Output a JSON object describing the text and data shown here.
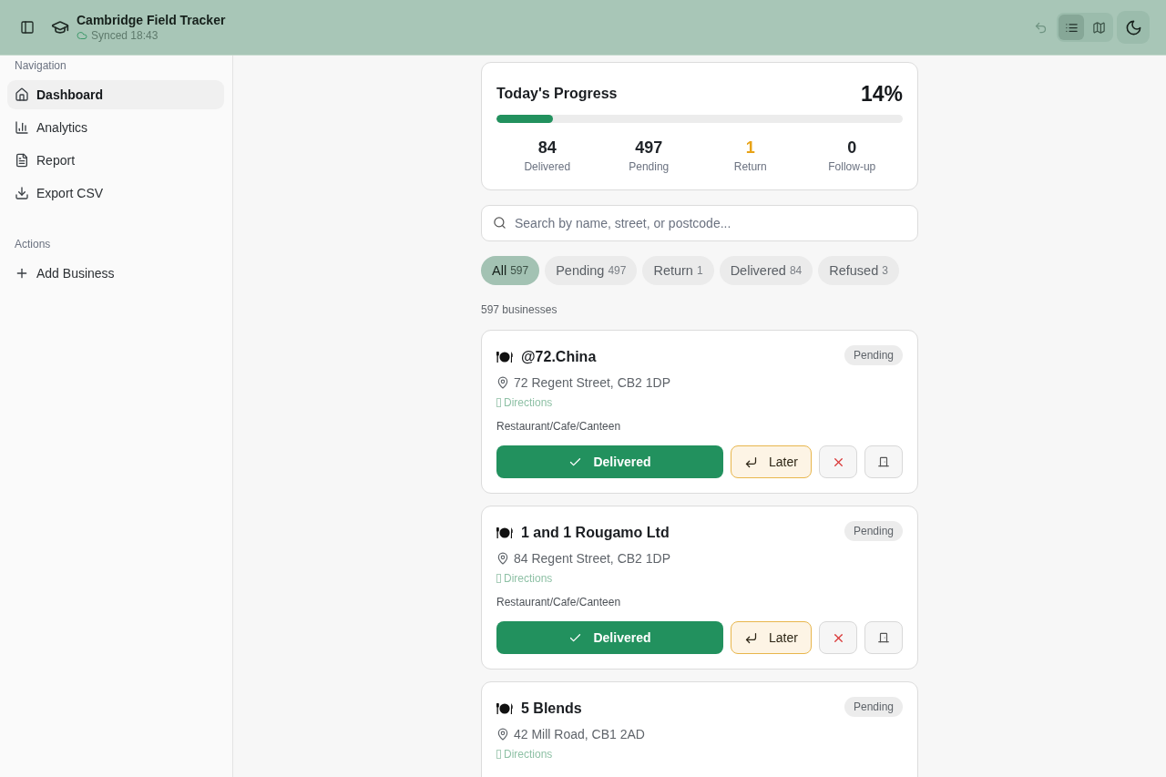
{
  "header": {
    "title": "Cambridge Field Tracker",
    "sync_status": "Synced 18:43",
    "views": [
      {
        "selected": true
      },
      {
        "selected": false
      }
    ]
  },
  "sidebar": {
    "sections": [
      {
        "heading": "Navigation",
        "items": [
          {
            "label": "Dashboard",
            "selected": true
          },
          {
            "label": "Analytics",
            "selected": false
          },
          {
            "label": "Report",
            "selected": false
          },
          {
            "label": "Export CSV",
            "selected": false
          }
        ]
      },
      {
        "heading": "Actions",
        "items": [
          {
            "label": "Add Business",
            "selected": false
          }
        ]
      }
    ]
  },
  "progress": {
    "title": "Today's Progress",
    "percent": "14%",
    "level": 0.14,
    "stats": [
      {
        "value": "84",
        "label": "Delivered",
        "color": "#1f2328"
      },
      {
        "value": "497",
        "label": "Pending",
        "color": "#1f2328"
      },
      {
        "value": "1",
        "label": "Return",
        "color": "#e8a317"
      },
      {
        "value": "0",
        "label": "Follow-up",
        "color": "#1f2328"
      }
    ]
  },
  "search": {
    "placeholder": "Search by name, street, or postcode..."
  },
  "filters": [
    {
      "label": "All",
      "count": "597",
      "selected": true
    },
    {
      "label": "Pending",
      "count": "497",
      "selected": false
    },
    {
      "label": "Return",
      "count": "1",
      "selected": false
    },
    {
      "label": "Delivered",
      "count": "84",
      "selected": false
    },
    {
      "label": "Refused",
      "count": "3",
      "selected": false
    }
  ],
  "result_count": "597 businesses",
  "businesses": [
    {
      "name": "@72.China",
      "status": "Pending",
      "address": "72 Regent Street, CB2 1DP",
      "directions": "Directions",
      "category": "Restaurant/Cafe/Canteen",
      "buttons": [
        {
          "kind": "deliver",
          "label": "Delivered"
        },
        {
          "kind": "later",
          "label": "Later"
        },
        {
          "kind": "refuse"
        },
        {
          "kind": "closed"
        }
      ]
    },
    {
      "name": "1 and 1 Rougamo Ltd",
      "status": "Pending",
      "address": "84 Regent Street, CB2 1DP",
      "directions": "Directions",
      "category": "Restaurant/Cafe/Canteen",
      "buttons": [
        {
          "kind": "deliver",
          "label": "Delivered"
        },
        {
          "kind": "later",
          "label": "Later"
        },
        {
          "kind": "refuse"
        },
        {
          "kind": "closed"
        }
      ]
    },
    {
      "name": "5 Blends",
      "status": "Pending",
      "address": "42 Mill Road, CB1 2AD",
      "directions": "Directions"
    }
  ]
}
